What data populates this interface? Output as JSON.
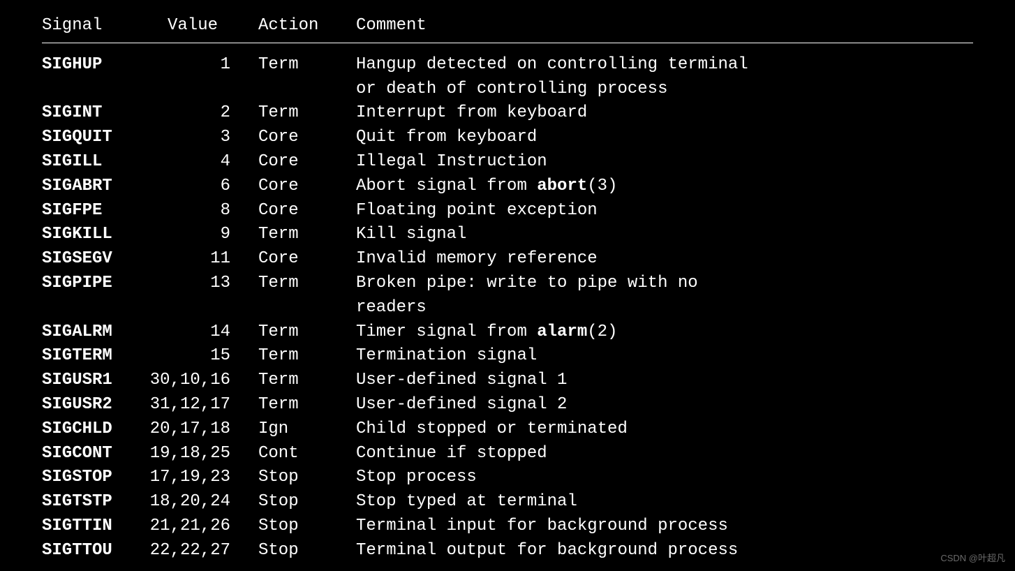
{
  "headers": {
    "signal": "Signal",
    "value": "Value",
    "action": "Action",
    "comment": "Comment"
  },
  "rows": [
    {
      "signal": "SIGHUP",
      "value": " 1",
      "action": "Term",
      "comment": "Hangup detected on controlling terminal\nor death of controlling process"
    },
    {
      "signal": "SIGINT",
      "value": " 2",
      "action": "Term",
      "comment": "Interrupt from keyboard"
    },
    {
      "signal": "SIGQUIT",
      "value": " 3",
      "action": "Core",
      "comment": "Quit from keyboard"
    },
    {
      "signal": "SIGILL",
      "value": " 4",
      "action": "Core",
      "comment": "Illegal Instruction"
    },
    {
      "signal": "SIGABRT",
      "value": " 6",
      "action": "Core",
      "comment_pre": "Abort signal from ",
      "comment_bold": "abort",
      "comment_post": "(3)"
    },
    {
      "signal": "SIGFPE",
      "value": " 8",
      "action": "Core",
      "comment": "Floating point exception"
    },
    {
      "signal": "SIGKILL",
      "value": " 9",
      "action": "Term",
      "comment": "Kill signal"
    },
    {
      "signal": "SIGSEGV",
      "value": "11",
      "action": "Core",
      "comment": "Invalid memory reference"
    },
    {
      "signal": "SIGPIPE",
      "value": "13",
      "action": "Term",
      "comment": "Broken pipe: write to pipe with no\nreaders"
    },
    {
      "signal": "SIGALRM",
      "value": "14",
      "action": "Term",
      "comment_pre": "Timer signal from ",
      "comment_bold": "alarm",
      "comment_post": "(2)"
    },
    {
      "signal": "SIGTERM",
      "value": "15",
      "action": "Term",
      "comment": "Termination signal"
    },
    {
      "signal": "SIGUSR1",
      "value": "30,10,16",
      "action": "Term",
      "comment": "User-defined signal 1"
    },
    {
      "signal": "SIGUSR2",
      "value": "31,12,17",
      "action": "Term",
      "comment": "User-defined signal 2"
    },
    {
      "signal": "SIGCHLD",
      "value": "20,17,18",
      "action": "Ign",
      "comment": "Child stopped or terminated"
    },
    {
      "signal": "SIGCONT",
      "value": "19,18,25",
      "action": "Cont",
      "comment": "Continue if stopped"
    },
    {
      "signal": "SIGSTOP",
      "value": "17,19,23",
      "action": "Stop",
      "comment": "Stop process"
    },
    {
      "signal": "SIGTSTP",
      "value": "18,20,24",
      "action": "Stop",
      "comment": "Stop typed at terminal"
    },
    {
      "signal": "SIGTTIN",
      "value": "21,21,26",
      "action": "Stop",
      "comment": "Terminal input for background process"
    },
    {
      "signal": "SIGTTOU",
      "value": "22,22,27",
      "action": "Stop",
      "comment": "Terminal output for background process"
    }
  ],
  "watermark": "CSDN @叶超凡"
}
